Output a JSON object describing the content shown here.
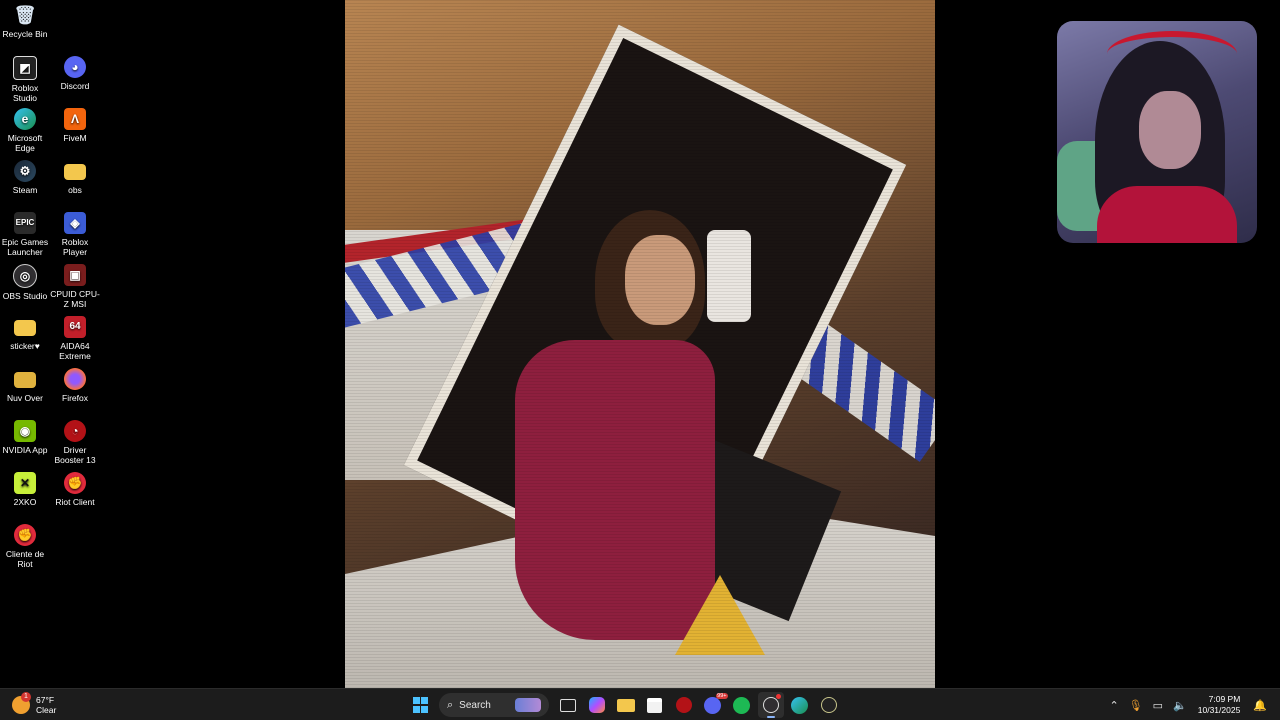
{
  "desktop": {
    "icons": [
      {
        "label": "Recycle Bin",
        "icon": "recycle-bin-icon"
      },
      {
        "label": "Roblox Studio",
        "icon": "roblox-studio-icon"
      },
      {
        "label": "Discord",
        "icon": "discord-icon"
      },
      {
        "label": "Microsoft Edge",
        "icon": "edge-icon"
      },
      {
        "label": "FiveM",
        "icon": "fivem-icon"
      },
      {
        "label": "Steam",
        "icon": "steam-icon"
      },
      {
        "label": "obs",
        "icon": "folder-icon"
      },
      {
        "label": "Epic Games Launcher",
        "icon": "epic-games-icon"
      },
      {
        "label": "Roblox Player",
        "icon": "roblox-player-icon"
      },
      {
        "label": "OBS Studio",
        "icon": "obs-studio-icon"
      },
      {
        "label": "CPUID CPU-Z MSI",
        "icon": "cpuz-icon"
      },
      {
        "label": "sticker♥",
        "icon": "folder-icon"
      },
      {
        "label": "AIDA64 Extreme",
        "icon": "aida64-icon"
      },
      {
        "label": "Nuv Over",
        "icon": "folder-icon"
      },
      {
        "label": "Firefox",
        "icon": "firefox-icon"
      },
      {
        "label": "NVIDIA App",
        "icon": "nvidia-icon"
      },
      {
        "label": "Driver Booster 13",
        "icon": "driver-booster-icon"
      },
      {
        "label": "2XKO",
        "icon": "2xko-icon"
      },
      {
        "label": "Riot Client",
        "icon": "riot-client-icon"
      },
      {
        "label": "Cliente de Riot",
        "icon": "riot-client-icon"
      }
    ]
  },
  "taskbar": {
    "weather": {
      "temp": "67°F",
      "condition": "Clear",
      "badge": "1"
    },
    "search_label": "Search",
    "clock": {
      "time": "7:09 PM",
      "date": "10/31/2025"
    },
    "discord_badge": "99+"
  },
  "colors": {
    "taskbar_bg": "#1c1c1c",
    "accent": "#4cc2ff"
  }
}
